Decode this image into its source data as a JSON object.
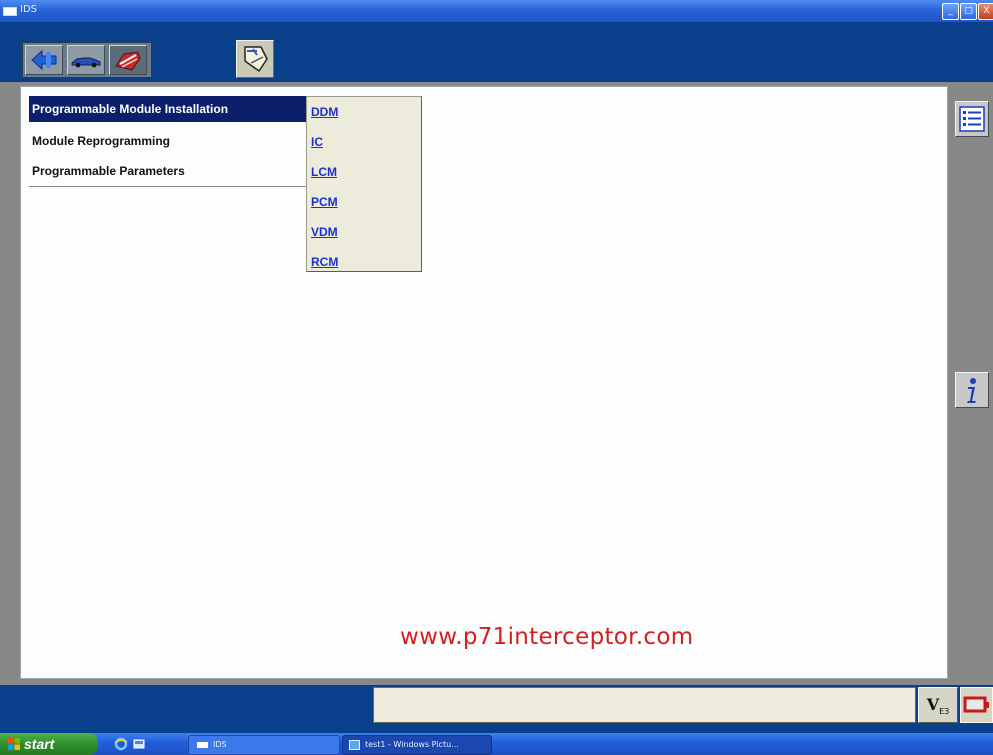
{
  "window": {
    "title": "IDS",
    "controls": {
      "minimize": "_",
      "maximize": "□",
      "close": "X"
    }
  },
  "toolbar": {
    "tabs": [
      {
        "icon": "back-arrow-icon"
      },
      {
        "icon": "vehicle-icon"
      },
      {
        "icon": "toolbox-icon"
      }
    ],
    "doc_icon": "module-programming-doc-icon"
  },
  "menu": {
    "items": [
      {
        "label": "Programmable Module Installation",
        "active": true
      },
      {
        "label": "Module Reprogramming",
        "active": false
      },
      {
        "label": "Programmable Parameters",
        "active": false
      }
    ]
  },
  "submenu": {
    "items": [
      "DDM",
      "IC",
      "LCM",
      "PCM",
      "VDM",
      "RCM"
    ]
  },
  "watermark": "www.p71interceptor.com",
  "side": {
    "list_icon": "list-icon",
    "info_icon": "info-icon"
  },
  "status": {
    "v_label": "V",
    "v_sub": "ЕЗ"
  },
  "taskbar": {
    "start_label": "start",
    "tasks": [
      {
        "label": "IDS"
      },
      {
        "label": "test1 - Windows Pictu..."
      }
    ]
  },
  "colors": {
    "chrome_blue": "#0a3f8c",
    "menu_active": "#0b1f6b",
    "link_blue": "#1a2fd9",
    "watermark_red": "#d41f1f"
  }
}
